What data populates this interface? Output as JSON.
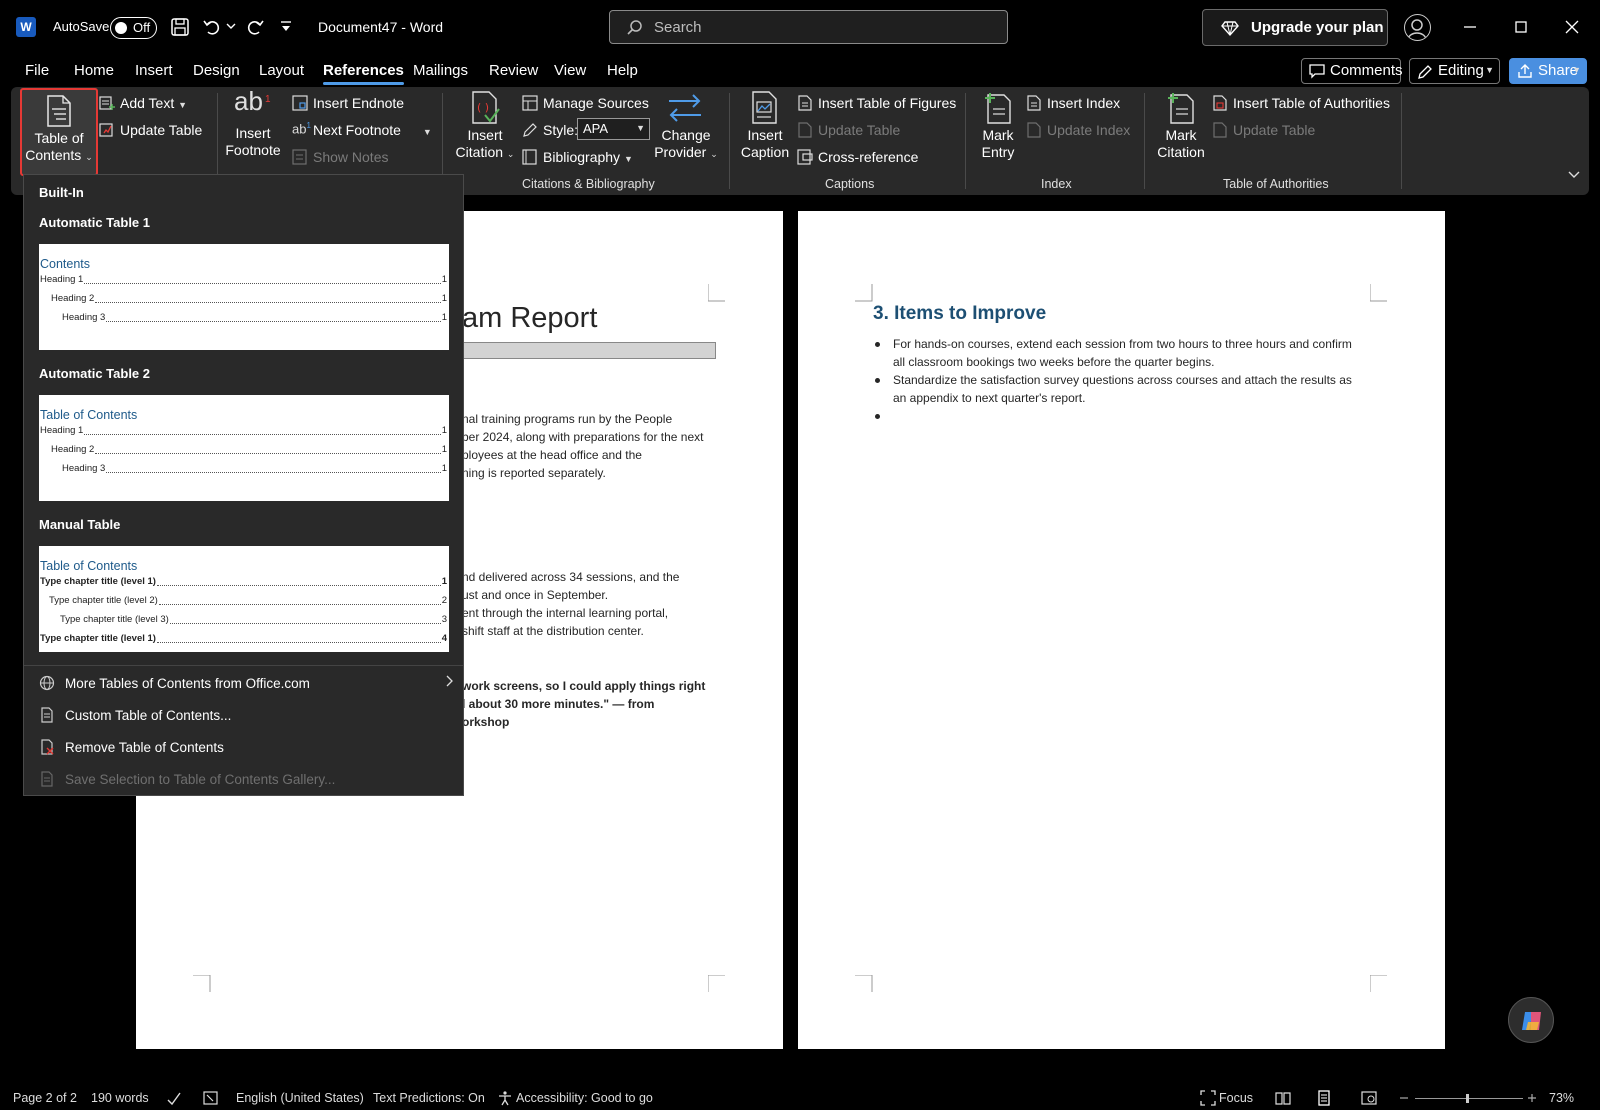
{
  "titlebar": {
    "autosave_label": "AutoSave",
    "autosave_state": "Off",
    "doc_title": "Document47  -  Word",
    "search_placeholder": "Search",
    "upgrade_label": "Upgrade your plan"
  },
  "menu": {
    "tabs": [
      "File",
      "Home",
      "Insert",
      "Design",
      "Layout",
      "References",
      "Mailings",
      "Review",
      "View",
      "Help"
    ],
    "active": "References",
    "comments_label": "Comments",
    "editing_label": "Editing",
    "share_label": "Share"
  },
  "ribbon": {
    "toc_label_1": "Table of",
    "toc_label_2": "Contents",
    "add_text": "Add Text",
    "update_table": "Update Table",
    "insert_footnote_1": "Insert",
    "insert_footnote_2": "Footnote",
    "insert_endnote": "Insert Endnote",
    "next_footnote": "Next Footnote",
    "show_notes": "Show Notes",
    "insert_citation_1": "Insert",
    "insert_citation_2": "Citation",
    "manage_sources": "Manage Sources",
    "style_label": "Style:",
    "style_value": "APA",
    "bibliography": "Bibliography",
    "change_provider_1": "Change",
    "change_provider_2": "Provider",
    "group_citations": "Citations & Bibliography",
    "insert_caption_1": "Insert",
    "insert_caption_2": "Caption",
    "insert_tof": "Insert Table of Figures",
    "update_table_2": "Update Table",
    "cross_reference": "Cross-reference",
    "group_captions": "Captions",
    "mark_entry_1": "Mark",
    "mark_entry_2": "Entry",
    "insert_index": "Insert Index",
    "update_index": "Update Index",
    "group_index": "Index",
    "mark_citation_1": "Mark",
    "mark_citation_2": "Citation",
    "insert_toa": "Insert Table of Authorities",
    "update_table_3": "Update Table",
    "group_toa": "Table of Authorities"
  },
  "toc_menu": {
    "section_builtin": "Built-In",
    "auto1_title": "Automatic Table 1",
    "auto1_preview_heading": "Contents",
    "auto2_title": "Automatic Table 2",
    "auto2_preview_heading": "Table of Contents",
    "manual_title": "Manual Table",
    "manual_preview_heading": "Table of Contents",
    "auto_lines": [
      {
        "text": "Heading 1",
        "page": "1"
      },
      {
        "text": "Heading 2",
        "page": "1"
      },
      {
        "text": "Heading 3",
        "page": "1"
      }
    ],
    "manual_lines": [
      {
        "text": "Type chapter title (level 1)",
        "page": "1"
      },
      {
        "text": "Type chapter title (level 2)",
        "page": "2"
      },
      {
        "text": "Type chapter title (level 3)",
        "page": "3"
      },
      {
        "text": "Type chapter title (level 1)",
        "page": "4"
      }
    ],
    "more_tables": "More Tables of Contents from Office.com",
    "custom_toc": "Custom Table of Contents...",
    "remove_toc": "Remove Table of Contents",
    "save_selection": "Save Selection to Table of Contents Gallery..."
  },
  "page1": {
    "title_fragment": "am Report",
    "para1": [
      "nal training programs run by the People",
      "ber 2024, along with preparations for the next",
      "ployees at the head office and the",
      "ning is reported separately."
    ],
    "para2": [
      "nd delivered across 34 sessions, and the",
      "ust and once in September.",
      "ent through the internal learning portal,",
      "shift staff at the distribution center."
    ],
    "quote": [
      "work screens, so I could apply things right",
      "l about 30 more minutes.\" — from",
      "orkshop"
    ]
  },
  "page2": {
    "heading": "3. Items to Improve",
    "bullets": [
      [
        "For hands-on courses, extend each session from two hours to three hours and confirm",
        "all classroom bookings two weeks before the quarter begins."
      ],
      [
        "Standardize the satisfaction survey questions across courses and attach the results as",
        "an appendix to next quarter's report."
      ],
      [
        ""
      ]
    ]
  },
  "status": {
    "page": "Page 2 of 2",
    "words": "190 words",
    "language": "English (United States)",
    "predictions": "Text Predictions: On",
    "accessibility": "Accessibility: Good to go",
    "focus": "Focus",
    "zoom": "73%"
  },
  "colors": {
    "accent": "#4f9be8",
    "highlight_border": "#e53935",
    "heading_blue": "#1d4f73"
  }
}
